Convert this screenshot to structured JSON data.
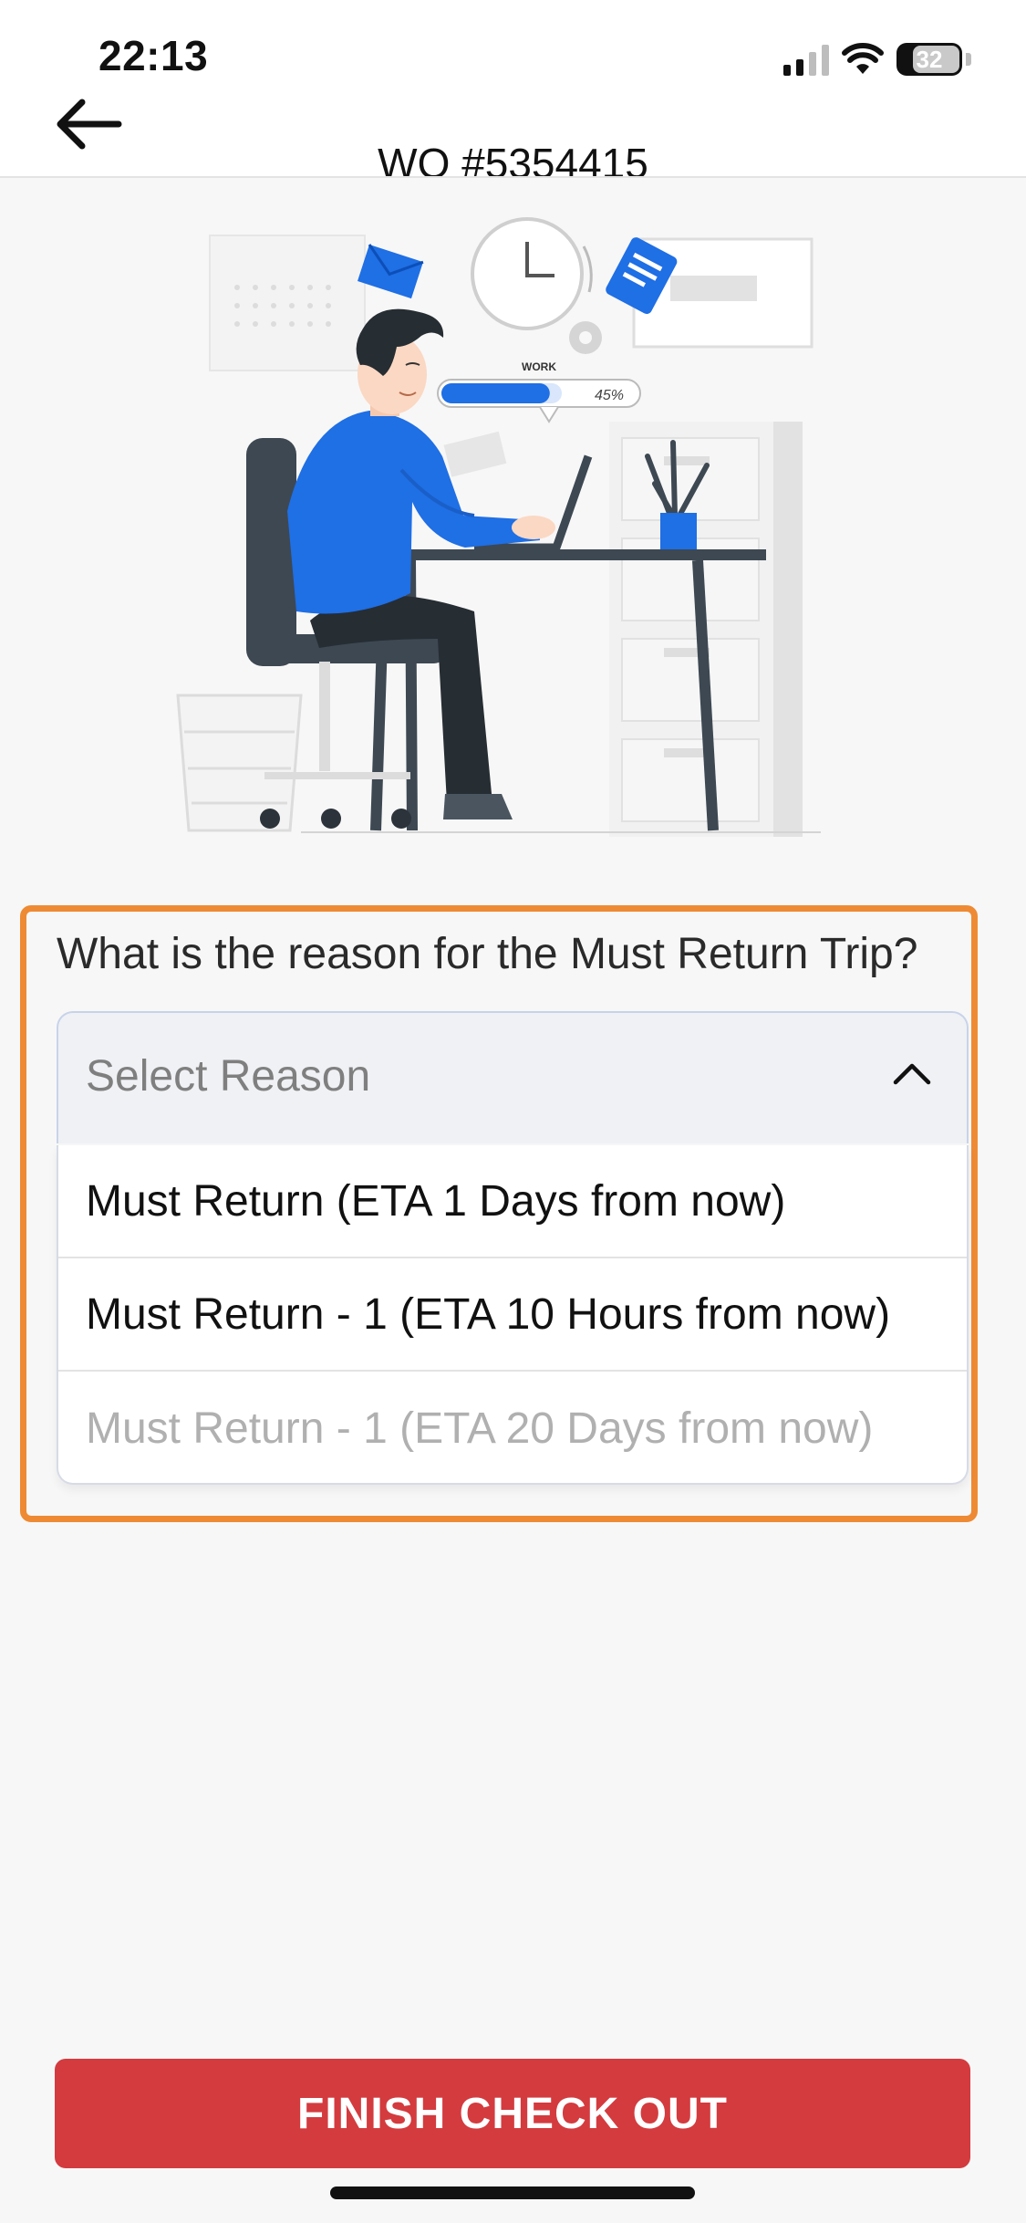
{
  "status_bar": {
    "time": "22:13",
    "battery": "32",
    "icons": [
      "signal-icon",
      "wifi-icon",
      "battery-icon"
    ]
  },
  "header": {
    "title": "WO #5354415",
    "back_icon": "back-arrow-icon"
  },
  "illustration": {
    "bubble_label": "WORK",
    "progress_text": "45%",
    "progress": 0.45
  },
  "form": {
    "question": "What is the reason for the Must Return Trip?",
    "select_placeholder": "Select Reason",
    "options": [
      "Must Return (ETA 1 Days from now)",
      "Must Return - 1 (ETA 10 Hours from now)",
      "Must Return - 1 (ETA 20 Days from now)"
    ]
  },
  "footer": {
    "finish_label": "FINISH CHECK OUT"
  },
  "colors": {
    "accent_outline": "#ee8a33",
    "finish_button": "#d33b3f",
    "illustration_blue": "#1f6fe5"
  }
}
